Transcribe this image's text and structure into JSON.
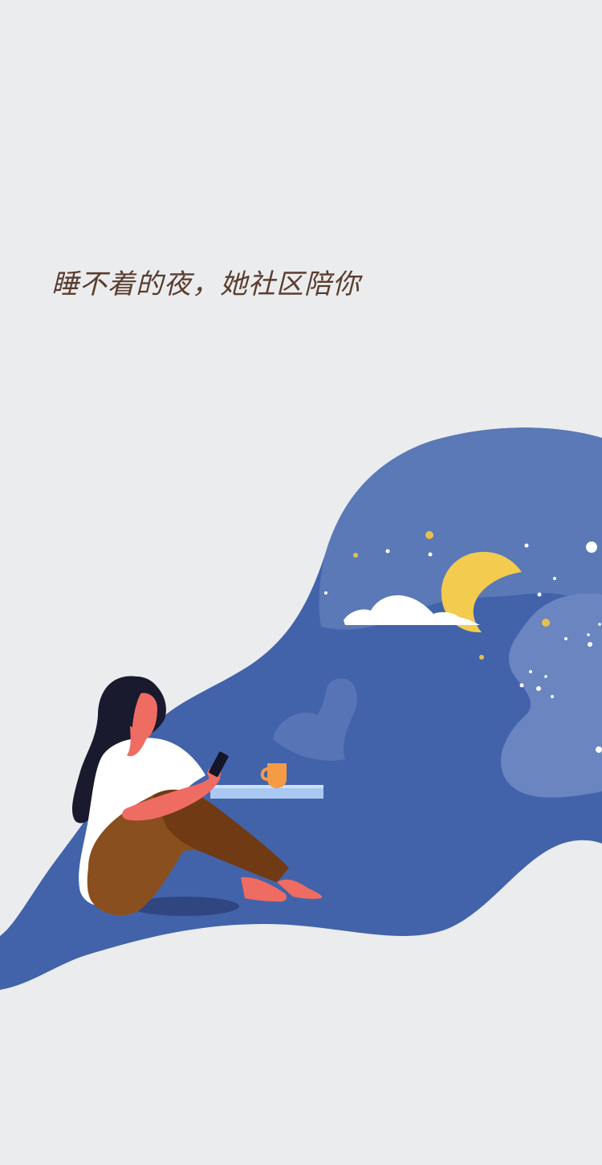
{
  "splash": {
    "slogan": "睡不着的夜，她社区陪你"
  },
  "colors": {
    "background": "#ebecee",
    "night_sky": "#4263aa",
    "sky_light": "#5a79b6",
    "moon": "#f2cb4f",
    "slogan_text": "#5a3d2e"
  },
  "illustration": {
    "icons": [
      "woman-icon",
      "phone-icon",
      "mug-icon",
      "moon-icon",
      "cloud-icon",
      "stars-icon",
      "steam-icon"
    ]
  }
}
